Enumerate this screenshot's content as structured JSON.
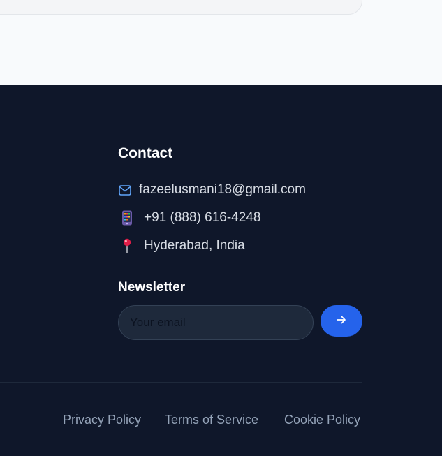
{
  "contact": {
    "heading": "Contact",
    "email": "fazeelusmani18@gmail.com",
    "phone": "+91 (888) 616-4248",
    "location": "Hyderabad, India",
    "icons": {
      "email": "mail-icon",
      "phone": "mobile-phone-icon",
      "location": "location-pin-icon"
    }
  },
  "newsletter": {
    "heading": "Newsletter",
    "placeholder": "Your email",
    "submit_icon": "arrow-right-icon"
  },
  "legal": {
    "links": [
      "Privacy Policy",
      "Terms of Service",
      "Cookie Policy"
    ]
  },
  "colors": {
    "background": "#0f172a",
    "accent": "#2563eb",
    "text": "#d6dbe3",
    "muted_link": "#94a3b8"
  }
}
